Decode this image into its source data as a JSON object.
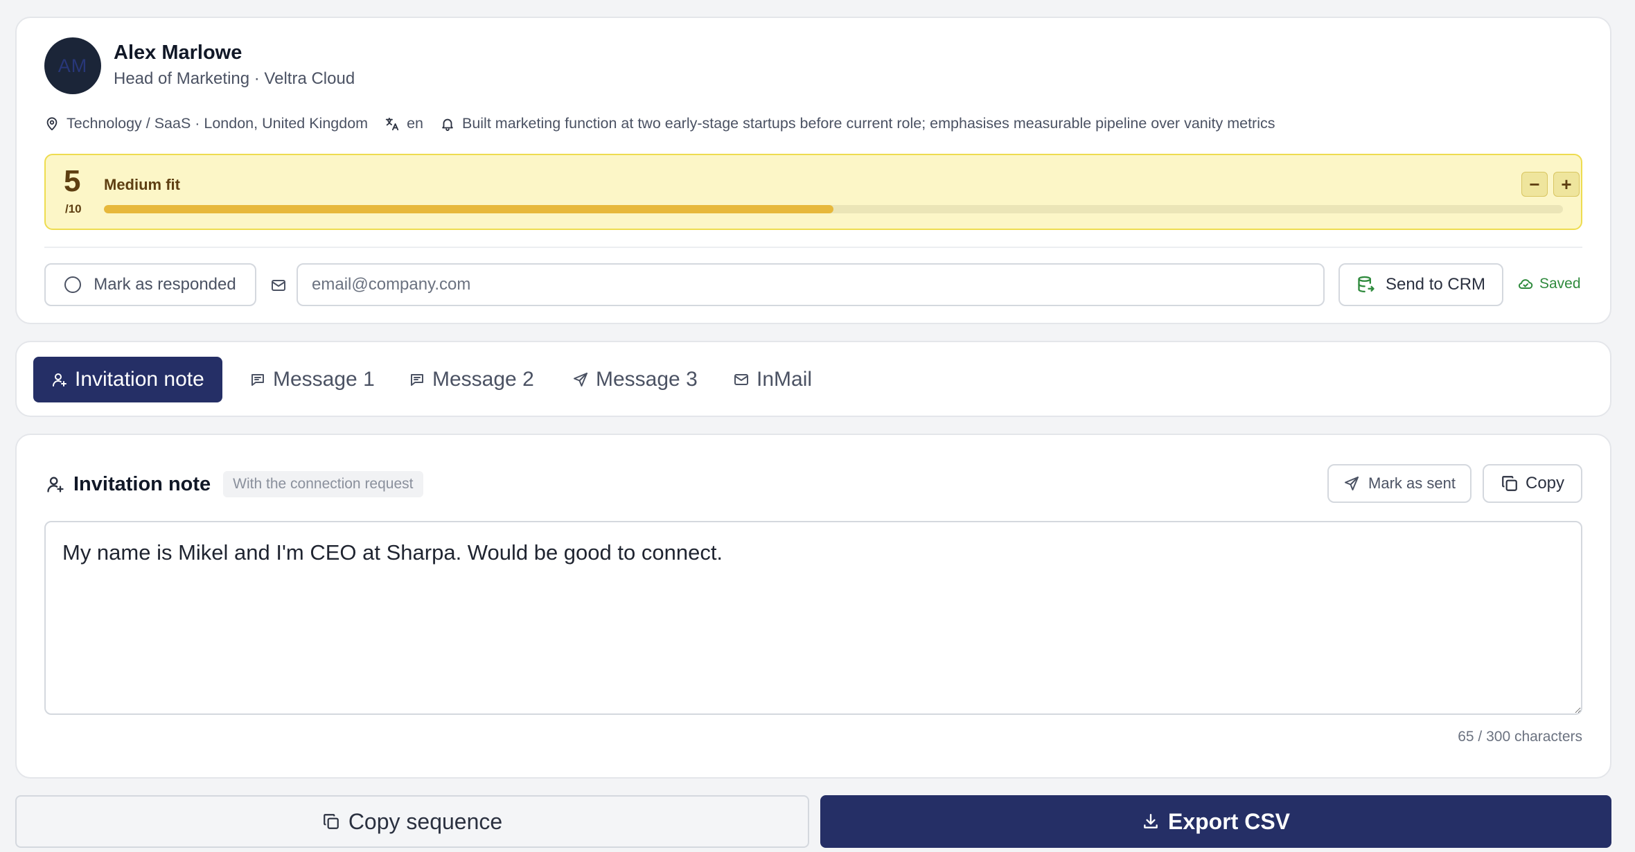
{
  "profile": {
    "avatar_initials": "AM",
    "name": "Alex Marlowe",
    "subtitle": "Head of Marketing · Veltra Cloud",
    "location": "Technology / SaaS · London, United Kingdom",
    "language": "en",
    "insight": "Built marketing function at two early-stage startups before current role; emphasises measurable pipeline over vanity metrics",
    "icons": {
      "location": "map-pin-icon",
      "language": "translate-icon",
      "insight": "bell-icon"
    }
  },
  "fit": {
    "score": "5",
    "denominator": "/10",
    "label": "Medium fit",
    "progress_fraction": 0.5,
    "decrement_label": "−",
    "increment_label": "+",
    "colors": {
      "background": "#fcf6c7",
      "border": "#eedc4f",
      "fill": "#e7b83b",
      "text": "#5e3f12"
    }
  },
  "actions": {
    "responded_label": "Mark as responded",
    "email_placeholder": "email@company.com",
    "email_value": "",
    "send_crm_label": "Send to CRM",
    "saved_label": "Saved"
  },
  "tabs": [
    {
      "label": "Invitation note",
      "icon": "user-plus-icon",
      "active": true
    },
    {
      "label": "Message 1",
      "icon": "chat-icon",
      "active": false
    },
    {
      "label": "Message 2",
      "icon": "chat-icon",
      "active": false
    },
    {
      "label": "Message 3",
      "icon": "send-icon",
      "active": false
    },
    {
      "label": "InMail",
      "icon": "mail-icon",
      "active": false
    }
  ],
  "editor": {
    "title": "Invitation note",
    "badge": "With the connection request",
    "mark_sent_label": "Mark as sent",
    "copy_label": "Copy",
    "text": "My name is Mikel and I'm CEO at Sharpa. Would be good to connect.",
    "char_count": "65 / 300 characters"
  },
  "footer": {
    "copy_sequence_label": "Copy sequence",
    "export_label": "Export CSV"
  },
  "theme": {
    "accent": "#252f66",
    "success": "#2f8a3d"
  }
}
